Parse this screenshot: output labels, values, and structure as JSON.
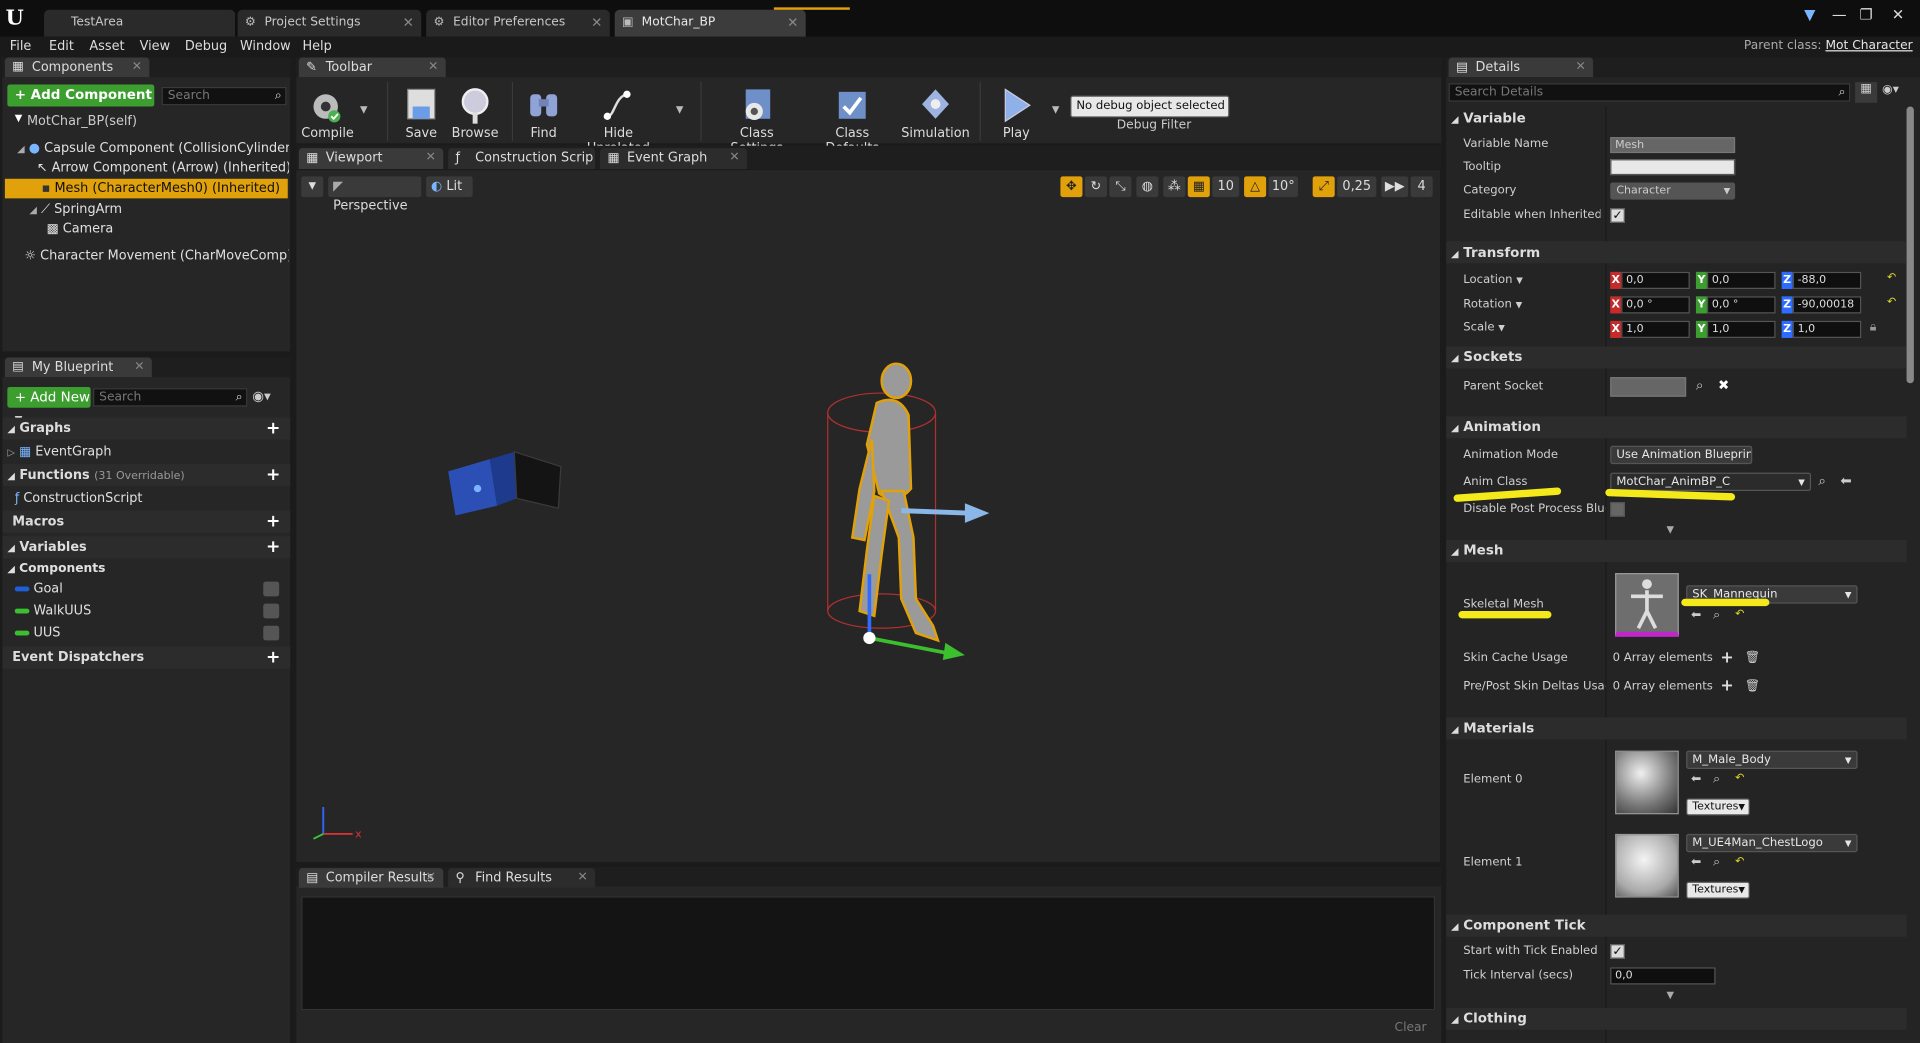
{
  "tabs": [
    {
      "label": "TestArea"
    },
    {
      "label": "Project Settings"
    },
    {
      "label": "Editor Preferences"
    },
    {
      "label": "MotChar_BP"
    }
  ],
  "menu": [
    "File",
    "Edit",
    "Asset",
    "View",
    "Debug",
    "Window",
    "Help"
  ],
  "parent_class": {
    "label": "Parent class:",
    "value": "Mot Character"
  },
  "components": {
    "tab": "Components",
    "add_label": "+ Add Component",
    "search_placeholder": "Search",
    "items": [
      "MotChar_BP(self)",
      "Capsule Component (CollisionCylinder) (Inherited)",
      "Arrow Component (Arrow) (Inherited)",
      "Mesh (CharacterMesh0) (Inherited)",
      "SpringArm",
      "Camera",
      "Character Movement (CharMoveComp) (Inherited)"
    ]
  },
  "my_blueprint": {
    "tab": "My Blueprint",
    "add_label": "+ Add New",
    "search_placeholder": "Search",
    "graphs": "Graphs",
    "event_graph": "EventGraph",
    "functions": "Functions",
    "overridable": "(31 Overridable)",
    "construction_script": "ConstructionScript",
    "macros": "Macros",
    "variables": "Variables",
    "components": "Components",
    "vars": [
      {
        "name": "Goal",
        "color": "#1f5fd6"
      },
      {
        "name": "WalkUUS",
        "color": "#3cbf2f"
      },
      {
        "name": "UUS",
        "color": "#3cbf2f"
      }
    ],
    "event_dispatchers": "Event Dispatchers"
  },
  "toolbar": {
    "tab": "Toolbar",
    "buttons": [
      "Compile",
      "Save",
      "Browse",
      "Find",
      "Hide Unrelated",
      "Class Settings",
      "Class Defaults",
      "Simulation",
      "Play"
    ],
    "debug_object": "No debug object selected",
    "debug_filter": "Debug Filter"
  },
  "editor_tabs": [
    "Viewport",
    "Construction Scrip",
    "Event Graph"
  ],
  "viewport": {
    "perspective": "Perspective",
    "lit": "Lit",
    "grid_snap": "10",
    "rot_snap": "10°",
    "scale_snap": "0,25",
    "cam_speed": "4"
  },
  "bottom": {
    "tabs": [
      "Compiler Results",
      "Find Results"
    ],
    "clear": "Clear"
  },
  "details": {
    "tab": "Details",
    "search_placeholder": "Search Details",
    "variable": {
      "title": "Variable",
      "name_label": "Variable Name",
      "name_value": "Mesh",
      "tooltip_label": "Tooltip",
      "category_label": "Category",
      "category_value": "Character",
      "editable_label": "Editable when Inherited"
    },
    "transform": {
      "title": "Transform",
      "location_label": "Location",
      "location": [
        "0,0",
        "0,0",
        "-88,0"
      ],
      "rotation_label": "Rotation",
      "rotation": [
        "0,0 °",
        "0,0 °",
        "-90,00018"
      ],
      "scale_label": "Scale",
      "scale": [
        "1,0",
        "1,0",
        "1,0"
      ]
    },
    "sockets": {
      "title": "Sockets",
      "parent_socket_label": "Parent Socket"
    },
    "animation": {
      "title": "Animation",
      "mode_label": "Animation Mode",
      "mode_value": "Use Animation Blueprint",
      "anim_class_label": "Anim Class",
      "anim_class_value": "MotChar_AnimBP_C",
      "disable_label": "Disable Post Process Blueprint"
    },
    "mesh": {
      "title": "Mesh",
      "skeletal_label": "Skeletal Mesh",
      "skeletal_value": "SK_Mannequin",
      "skin_cache_label": "Skin Cache Usage",
      "skin_cache_value": "0 Array elements",
      "prepost_label": "Pre/Post Skin Deltas Usage",
      "prepost_value": "0 Array elements"
    },
    "materials": {
      "title": "Materials",
      "element0_label": "Element 0",
      "element0_value": "M_Male_Body",
      "element1_label": "Element 1",
      "element1_value": "M_UE4Man_ChestLogo",
      "textures_label": "Textures"
    },
    "tick": {
      "title": "Component Tick",
      "start_label": "Start with Tick Enabled",
      "interval_label": "Tick Interval (secs)",
      "interval_value": "0,0"
    },
    "clothing": {
      "title": "Clothing"
    }
  },
  "colors": {
    "accent": "#e1a10a",
    "highlight": "#f4e91a",
    "green": "#3b9e2f"
  }
}
